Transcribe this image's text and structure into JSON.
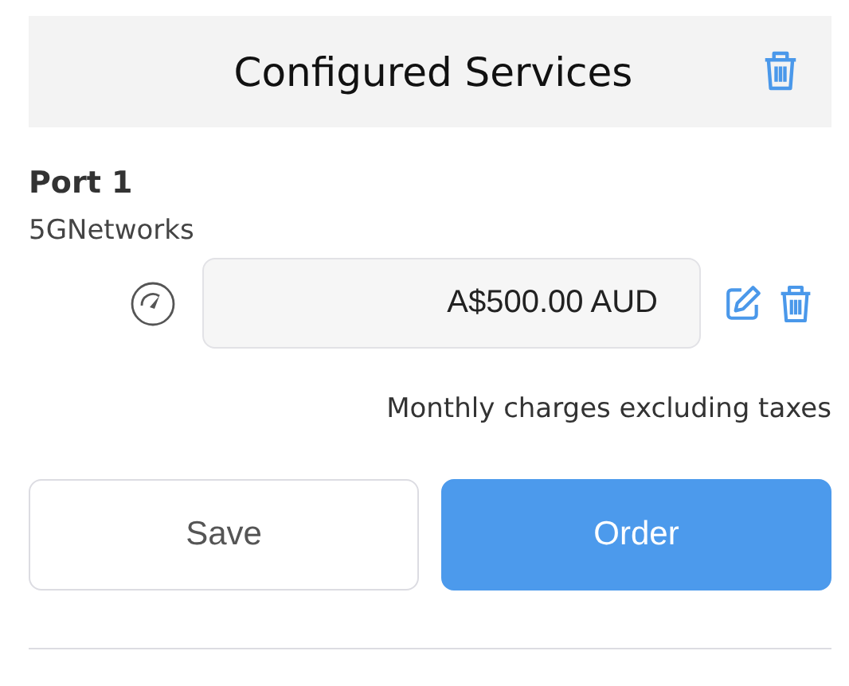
{
  "header": {
    "title": "Configured Services"
  },
  "services": [
    {
      "name": "Port 1",
      "provider": "5GNetworks",
      "price": "A$500.00 AUD"
    }
  ],
  "note": "Monthly charges excluding taxes",
  "buttons": [
    {
      "label": "Save",
      "kind": "secondary"
    },
    {
      "label": "Order",
      "kind": "primary"
    }
  ]
}
